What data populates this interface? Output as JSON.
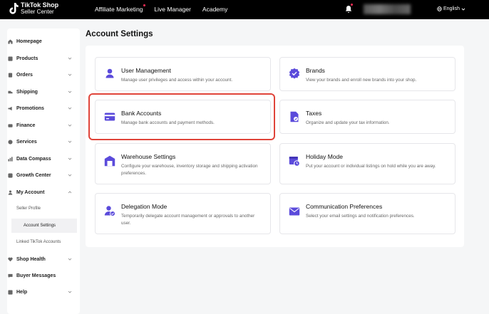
{
  "header": {
    "logo_line1": "TikTok Shop",
    "logo_line2": "Seller Center",
    "nav": [
      {
        "label": "Affiliate Marketing",
        "has_dot": true
      },
      {
        "label": "Live Manager",
        "has_dot": false
      },
      {
        "label": "Academy",
        "has_dot": false
      }
    ],
    "language": "English"
  },
  "sidebar": {
    "items": [
      {
        "label": "Homepage",
        "icon": "home-icon"
      },
      {
        "label": "Products",
        "icon": "products-icon"
      },
      {
        "label": "Orders",
        "icon": "orders-icon"
      },
      {
        "label": "Shipping",
        "icon": "truck-icon"
      },
      {
        "label": "Promotions",
        "icon": "megaphone-icon"
      },
      {
        "label": "Finance",
        "icon": "finance-icon"
      },
      {
        "label": "Services",
        "icon": "services-icon"
      },
      {
        "label": "Data Compass",
        "icon": "chart-icon"
      },
      {
        "label": "Growth Center",
        "icon": "growth-icon"
      },
      {
        "label": "My Account",
        "icon": "person-icon"
      },
      {
        "label": "Seller Profile"
      },
      {
        "label": "Account Settings"
      },
      {
        "label": "Linked TikTok Accounts"
      },
      {
        "label": "Shop Health",
        "icon": "heart-icon"
      },
      {
        "label": "Buyer Messages",
        "icon": "message-icon"
      },
      {
        "label": "Help",
        "icon": "help-icon"
      }
    ]
  },
  "page": {
    "title": "Account Settings"
  },
  "cards": [
    {
      "title": "User Management",
      "desc": "Manage user privileges and access within your account.",
      "icon": "user-icon"
    },
    {
      "title": "Brands",
      "desc": "View your brands and enroll new brands into your shop.",
      "icon": "badge-check-icon"
    },
    {
      "title": "Bank Accounts",
      "desc": "Manage bank accounts and payment methods.",
      "icon": "credit-card-icon"
    },
    {
      "title": "Taxes",
      "desc": "Organize and update your tax information.",
      "icon": "tax-document-icon"
    },
    {
      "title": "Warehouse Settings",
      "desc": "Configure your warehouse, inventory storage and shipping activation preferences.",
      "icon": "warehouse-icon"
    },
    {
      "title": "Holiday Mode",
      "desc": "Put your account or individual listings on hold while you are away.",
      "icon": "calendar-clock-icon"
    },
    {
      "title": "Delegation Mode",
      "desc": "Temporarily delegate account management or approvals to another user.",
      "icon": "user-check-icon"
    },
    {
      "title": "Communication Preferences",
      "desc": "Select your email settings and notification preferences.",
      "icon": "envelope-icon"
    }
  ],
  "colors": {
    "accent": "#5b4bdb",
    "highlight": "#e0443a",
    "notification": "#fe2c55"
  }
}
